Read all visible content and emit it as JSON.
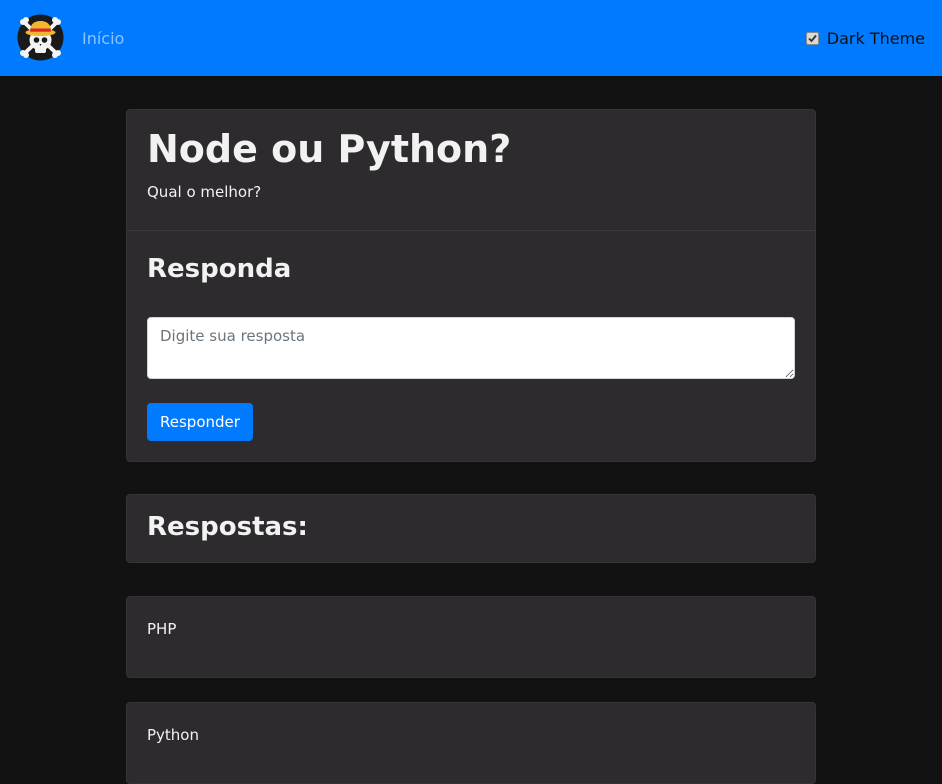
{
  "navbar": {
    "logo_icon": "straw-hat-jolly-roger-logo",
    "home_link": "Início",
    "theme_toggle": {
      "label": "Dark Theme",
      "checked": true
    },
    "background": "#007bff"
  },
  "question": {
    "title": "Node ou Python?",
    "description": "Qual o melhor?"
  },
  "reply_form": {
    "heading": "Responda",
    "input_placeholder": "Digite sua resposta",
    "input_value": "",
    "submit_label": "Responder"
  },
  "answers": {
    "heading": "Respostas:",
    "items": [
      {
        "text": "PHP"
      },
      {
        "text": "Python"
      }
    ]
  },
  "colors": {
    "page_background": "#121212",
    "card_background": "#2d2b2d",
    "accent": "#007bff"
  }
}
